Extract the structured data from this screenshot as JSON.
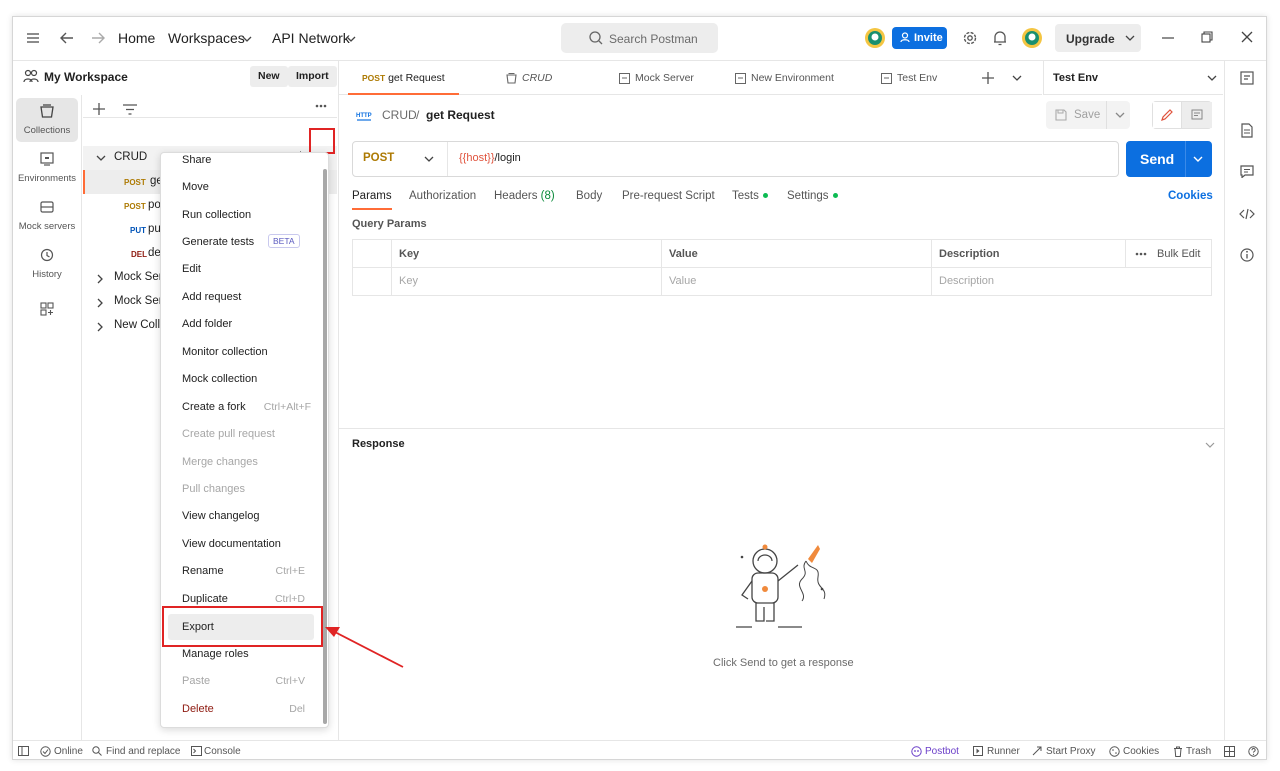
{
  "topbar": {
    "home": "Home",
    "workspaces": "Workspaces",
    "api_network": "API Network",
    "search_placeholder": "Search Postman",
    "invite": "Invite",
    "upgrade": "Upgrade"
  },
  "workspace": {
    "name": "My Workspace",
    "new": "New",
    "import": "Import"
  },
  "rail": [
    {
      "label": "Collections"
    },
    {
      "label": "Environments"
    },
    {
      "label": "Mock servers"
    },
    {
      "label": "History"
    }
  ],
  "tree": {
    "collection": "CRUD",
    "requests": [
      {
        "method": "POST",
        "name": "ge"
      },
      {
        "method": "POST",
        "name": "po"
      },
      {
        "method": "PUT",
        "name": "pu"
      },
      {
        "method": "DEL",
        "name": "de"
      }
    ],
    "others": [
      "Mock Ser",
      "Mock Ser",
      "New Colle"
    ]
  },
  "menu": [
    {
      "label": "Share"
    },
    {
      "label": "Move"
    },
    {
      "label": "Run collection"
    },
    {
      "label": "Generate tests",
      "badge": "BETA"
    },
    {
      "label": "Edit"
    },
    {
      "label": "Add request"
    },
    {
      "label": "Add folder"
    },
    {
      "label": "Monitor collection"
    },
    {
      "label": "Mock collection"
    },
    {
      "label": "Create a fork",
      "shortcut": "Ctrl+Alt+F"
    },
    {
      "label": "Create pull request",
      "disabled": true
    },
    {
      "label": "Merge changes",
      "disabled": true
    },
    {
      "label": "Pull changes",
      "disabled": true
    },
    {
      "label": "View changelog"
    },
    {
      "label": "View documentation"
    },
    {
      "label": "Rename",
      "shortcut": "Ctrl+E"
    },
    {
      "label": "Duplicate",
      "shortcut": "Ctrl+D"
    },
    {
      "label": "Export",
      "highlight": true
    },
    {
      "label": "Manage roles"
    },
    {
      "label": "Paste",
      "shortcut": "Ctrl+V",
      "disabled": true
    },
    {
      "label": "Delete",
      "shortcut": "Del",
      "danger": true
    }
  ],
  "tabs": [
    {
      "method": "POST",
      "label": "get Request"
    },
    {
      "label": "CRUD"
    },
    {
      "label": "Mock Server"
    },
    {
      "label": "New Environment"
    },
    {
      "label": "Test Env"
    }
  ],
  "env": {
    "name": "Test Env"
  },
  "request": {
    "crumb_parent": "CRUD",
    "crumb_sep": "/",
    "crumb_current": "get Request",
    "save": "Save",
    "method": "POST",
    "url_var": "{{host}}",
    "url_path": "/login",
    "send": "Send",
    "cookies": "Cookies"
  },
  "reqtabs": {
    "params": "Params",
    "authorization": "Authorization",
    "headers": "Headers",
    "headers_count": "(8)",
    "body": "Body",
    "prerequest": "Pre-request Script",
    "tests": "Tests",
    "settings": "Settings"
  },
  "query": {
    "title": "Query Params",
    "col_key": "Key",
    "col_value": "Value",
    "col_desc": "Description",
    "bulk_edit": "Bulk Edit",
    "ph_key": "Key",
    "ph_value": "Value",
    "ph_desc": "Description"
  },
  "response": {
    "title": "Response",
    "empty": "Click Send to get a response"
  },
  "statusbar": {
    "online": "Online",
    "find": "Find and replace",
    "console": "Console",
    "postbot": "Postbot",
    "runner": "Runner",
    "proxy": "Start Proxy",
    "cookies": "Cookies",
    "trash": "Trash"
  },
  "colors": {
    "accent": "#ff6c37",
    "primary": "#0c6fe0",
    "post": "#ad7a03",
    "put": "#0053b8",
    "del": "#8e1a10",
    "highlight_box": "#e02424"
  }
}
